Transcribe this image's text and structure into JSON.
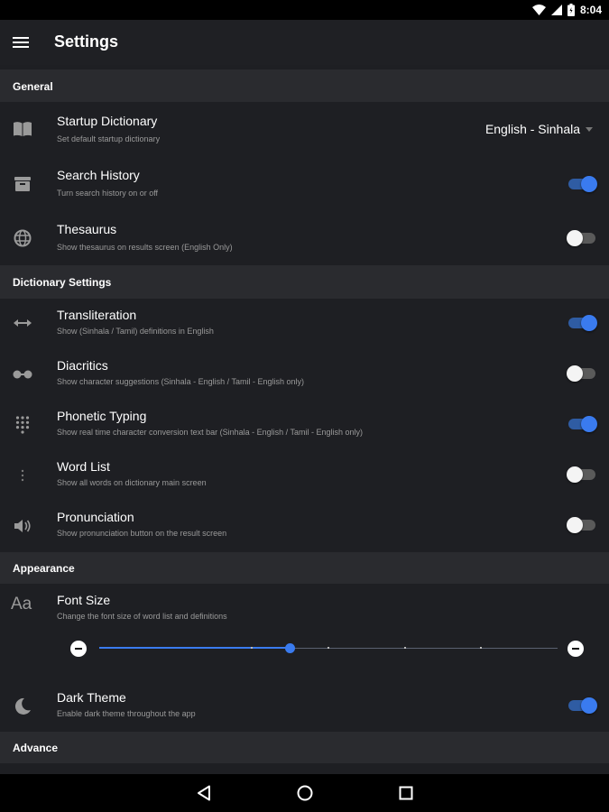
{
  "status_bar": {
    "time": "8:04",
    "icons": [
      "wifi-icon",
      "cellular-icon",
      "battery-icon"
    ]
  },
  "app_bar": {
    "title": "Settings",
    "menu_icon": "menu-icon"
  },
  "sections": {
    "general": "General",
    "dictionary": "Dictionary Settings",
    "appearance": "Appearance",
    "advance": "Advance"
  },
  "settings": {
    "startup_dictionary": {
      "title": "Startup Dictionary",
      "subtitle": "Set default startup dictionary",
      "value": "English - Sinhala",
      "icon": "book-icon"
    },
    "search_history": {
      "title": "Search History",
      "subtitle": "Turn search history on or off",
      "enabled": true,
      "icon": "archive-icon"
    },
    "thesaurus": {
      "title": "Thesaurus",
      "subtitle": "Show thesaurus on results screen (English Only)",
      "enabled": false,
      "icon": "globe-icon"
    },
    "transliteration": {
      "title": "Transliteration",
      "subtitle": "Show (Sinhala / Tamil) definitions in English",
      "enabled": true,
      "icon": "swap-arrows-icon"
    },
    "diacritics": {
      "title": "Diacritics",
      "subtitle": "Show character suggestions (Sinhala - English / Tamil - English only)",
      "enabled": false,
      "icon": "dots-icon"
    },
    "phonetic_typing": {
      "title": "Phonetic Typing",
      "subtitle": "Show real time character conversion text bar (Sinhala - English / Tamil - English only)",
      "enabled": true,
      "icon": "dialpad-icon"
    },
    "word_list": {
      "title": "Word List",
      "subtitle": "Show all words on dictionary main screen",
      "enabled": false,
      "icon": "vertical-dots-icon"
    },
    "pronunciation": {
      "title": "Pronunciation",
      "subtitle": "Show pronunciation button on the result screen",
      "enabled": false,
      "icon": "speaker-icon"
    },
    "font_size": {
      "title": "Font Size",
      "subtitle": "Change the font size of word list and definitions",
      "icon": "font-size-icon",
      "steps": 6,
      "selected_step": 1
    },
    "dark_theme": {
      "title": "Dark Theme",
      "subtitle": "Enable dark theme throughout the app",
      "enabled": true,
      "icon": "moon-icon"
    }
  },
  "nav_bar": {
    "icons": [
      "back-icon",
      "home-icon",
      "recents-icon"
    ]
  },
  "colors": {
    "accent": "#3a7bef",
    "background": "#1e1f23",
    "section_header": "#2a2b2f",
    "app_bar": "#1f2024"
  }
}
